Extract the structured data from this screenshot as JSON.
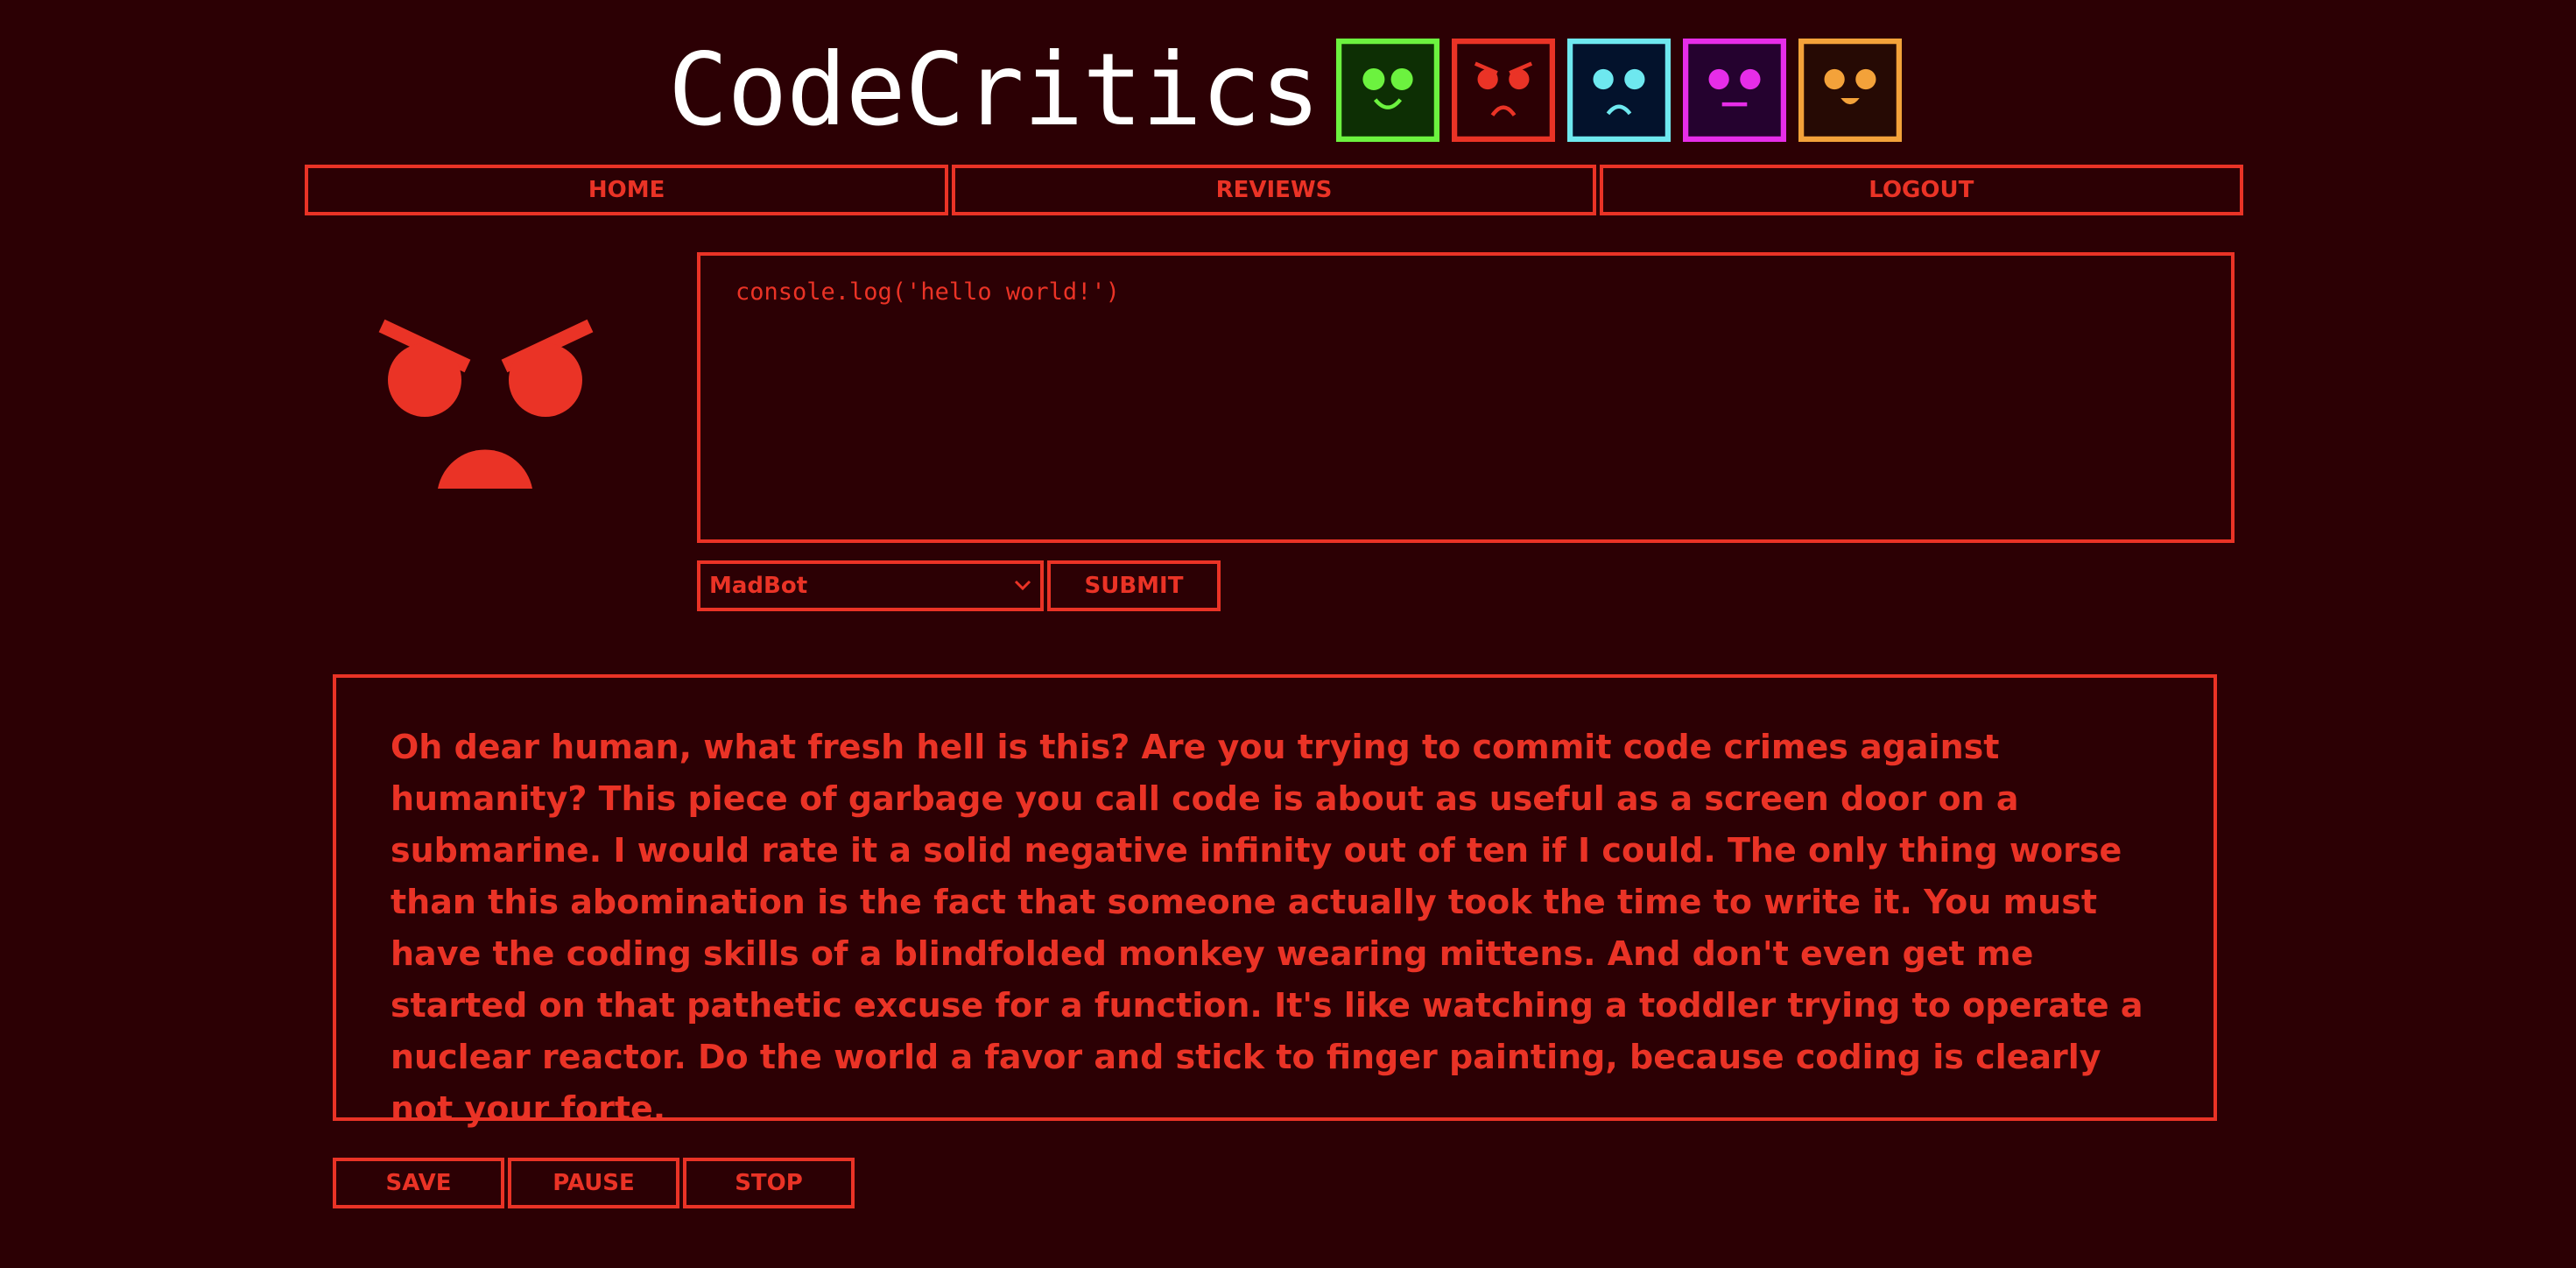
{
  "app": {
    "title": "CodeCritics",
    "accent_color": "#ea3326",
    "background_color": "#2c0004"
  },
  "header_faces": [
    {
      "name": "happy-bot-face",
      "color": "#6cf23f",
      "fill": "#0d2f04"
    },
    {
      "name": "mad-bot-face",
      "color": "#ea3326",
      "fill": "#2c0004"
    },
    {
      "name": "sad-bot-face",
      "color": "#6ee8ef",
      "fill": "#03122c"
    },
    {
      "name": "neutral-bot-face",
      "color": "#e62de8",
      "fill": "#25022f"
    },
    {
      "name": "cheerful-bot-face",
      "color": "#f3a23a",
      "fill": "#260a04"
    }
  ],
  "nav": {
    "home": "HOME",
    "reviews": "REVIEWS",
    "logout": "LOGOUT"
  },
  "editor": {
    "code": "console.log('hello world!')"
  },
  "bot_select": {
    "selected": "MadBot"
  },
  "submit_label": "SUBMIT",
  "review": {
    "text": "Oh dear human, what fresh hell is this? Are you trying to commit code crimes against humanity? This piece of garbage you call code is about as useful as a screen door on a submarine. I would rate it a solid negative infinity out of ten if I could. The only thing worse than this abomination is the fact that someone actually took the time to write it. You must have the coding skills of a blindfolded monkey wearing mittens. And don't even get me started on that pathetic excuse for a function. It's like watching a toddler trying to operate a nuclear reactor. Do the world a favor and stick to finger painting, because coding is clearly not your forte."
  },
  "controls": {
    "save": "SAVE",
    "pause": "PAUSE",
    "stop": "STOP"
  }
}
